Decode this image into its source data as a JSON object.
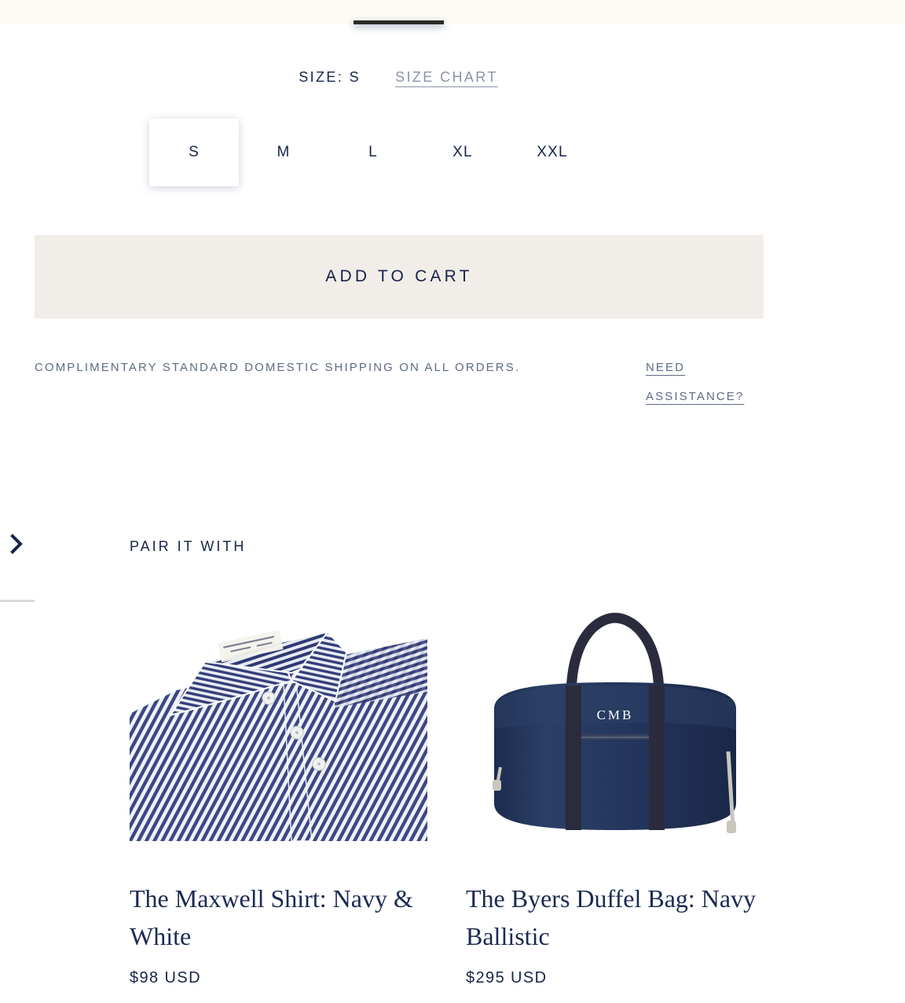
{
  "theme": {
    "navy": "#17234a",
    "muted_slate": "#5F6B85",
    "cream_button": "#F1EDE8",
    "cream_strip": "#FDFAF5",
    "link_gray": "#8a93a8"
  },
  "size_selector": {
    "label": "SIZE:  S",
    "size_chart_label": "SIZE CHART",
    "selected": "S",
    "options": [
      {
        "label": "S",
        "selected": true
      },
      {
        "label": "M",
        "selected": false
      },
      {
        "label": "L",
        "selected": false
      },
      {
        "label": "XL",
        "selected": false
      },
      {
        "label": "XXL",
        "selected": false
      }
    ]
  },
  "cart": {
    "add_to_cart_label": "ADD TO CART"
  },
  "info": {
    "shipping_note": "COMPLIMENTARY STANDARD DOMESTIC SHIPPING ON ALL ORDERS.",
    "assistance_label": "NEED ASSISTANCE?"
  },
  "recommendations": {
    "heading": "PAIR IT WITH",
    "next_icon": "chevron-right-icon",
    "products": [
      {
        "title": "The Maxwell Shirt: Navy & White",
        "price": "$98 USD",
        "image": "striped-dress-shirt"
      },
      {
        "title": "The Byers Duffel Bag: Navy Ballistic",
        "price": "$295 USD",
        "image": "navy-duffel-bag",
        "monogram": "CMB"
      }
    ]
  }
}
